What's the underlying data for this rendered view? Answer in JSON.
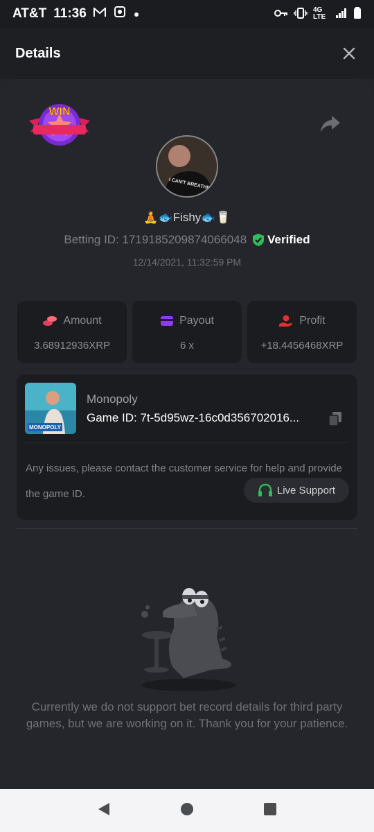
{
  "status_bar": {
    "carrier": "AT&T",
    "time": "11:36",
    "network": "4G LTE"
  },
  "header": {
    "title": "Details"
  },
  "bet": {
    "username": "🧘🐟Fishy🐟🥛",
    "betting_id_label": "Betting ID: 1719185209874066048",
    "verified_label": "Verified",
    "date": "12/14/2021, 11:32:59 PM",
    "avatar_shirt_text": "I CAN'T BREATHE",
    "win_badge_text": "WIN"
  },
  "stats": [
    {
      "label": "Amount",
      "value": "3.68912936XRP",
      "icon": "coins-icon",
      "color": "#e0405a"
    },
    {
      "label": "Payout",
      "value": "6 x",
      "icon": "wallet-icon",
      "color": "#8a3cf0"
    },
    {
      "label": "Profit",
      "value": "+18.4456468XRP",
      "icon": "hand-coin-icon",
      "color": "#e0302f"
    }
  ],
  "game": {
    "name": "Monopoly",
    "game_id": "Game ID: 7t-5d95wz-16c0d356702016...",
    "thumb_text": "MONOPOLY",
    "support_text": "Any issues, please contact the customer service for help and provide the game ID.",
    "live_support_label": "Live Support"
  },
  "empty": {
    "message": "Currently we do not support bet record details for third party games, but we are working on it. Thank you for your patience."
  },
  "colors": {
    "verified_green": "#2ebd59",
    "live_support_green": "#2ebd59",
    "background": "#24252a"
  }
}
